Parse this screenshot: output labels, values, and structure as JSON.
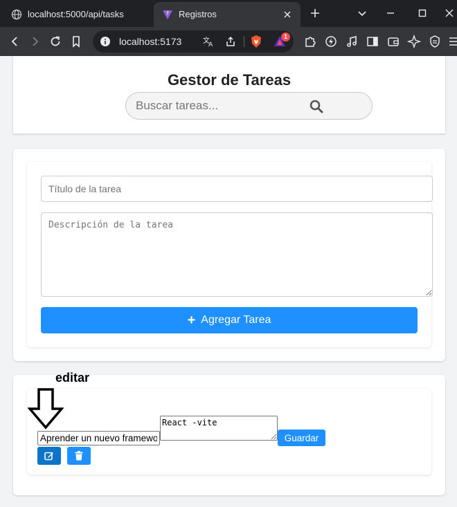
{
  "browser": {
    "tabs": [
      {
        "title": "localhost:5000/api/tasks",
        "favicon": "globe-icon",
        "active": false
      },
      {
        "title": "Registros",
        "favicon": "vite-icon",
        "active": true
      }
    ],
    "address": {
      "url": "localhost:5173"
    },
    "notification_count": "1"
  },
  "header": {
    "title": "Gestor de Tareas",
    "search_placeholder": "Buscar tareas..."
  },
  "form": {
    "title_placeholder": "Título de la tarea",
    "description_placeholder": "Descripción de la tarea",
    "add_button_label": "Agregar Tarea"
  },
  "task_list": {
    "items": [
      {
        "title_value": "Aprender un nuevo framewo",
        "description_value": "React -vite",
        "save_label": "Guardar",
        "completed": false
      }
    ]
  },
  "annotation": {
    "label": "editar"
  },
  "colors": {
    "primary": "#1e90ff",
    "edit_button": "#0c74c9",
    "chrome_dark": "#202124",
    "chrome_toolbar": "#35363a"
  }
}
